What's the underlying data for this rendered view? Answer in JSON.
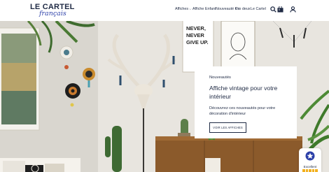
{
  "brand": {
    "logo_top": "LE CARTEL",
    "logo_script": "français"
  },
  "nav": {
    "items": [
      {
        "label": "Affiches",
        "has_dropdown": true
      },
      {
        "label": "Affiche Enfant",
        "has_dropdown": false
      },
      {
        "label": "Nouveauté Co",
        "has_dropdown": false
      },
      {
        "label": "Pro deux",
        "has_dropdown": false
      },
      {
        "label": "Le Cartel",
        "has_dropdown": false
      }
    ],
    "cart_count": "0",
    "icons": [
      "search-icon",
      "cart-icon",
      "account-icon"
    ]
  },
  "hero": {
    "kicker": "Nouveautés",
    "title": "Affiche vintage pour votre intérieur",
    "description": "Découvrez ces nouveautés pour votre décoration d'intérieur",
    "button_label": "VOIR LES AFFICHES",
    "wall_poster_text": "NEVER, NEVER GIVE UP."
  },
  "review_widget": {
    "label": "Excellent",
    "rating": 5
  },
  "colors": {
    "brand_navy": "#1f2a44",
    "brand_blue": "#2b3fa8",
    "star_yellow": "#f2b01e",
    "background": "#ffffff"
  }
}
